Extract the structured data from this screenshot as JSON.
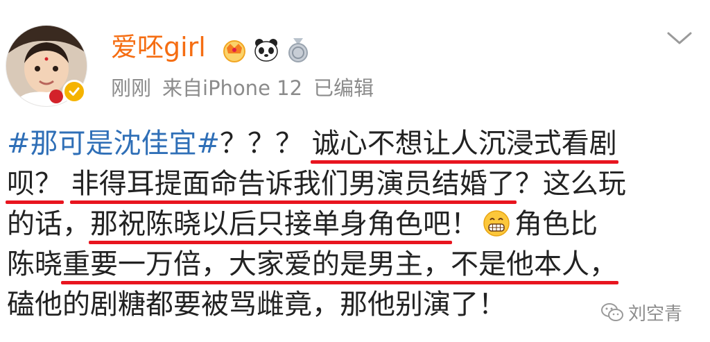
{
  "profile": {
    "username": "爱呸girl",
    "meta_time": "刚刚",
    "meta_source": "来自iPhone 12",
    "meta_edited": "已编辑",
    "badges": [
      "crown-badge-icon",
      "panda-icon",
      "medal-icon"
    ]
  },
  "post": {
    "line1_tag": "#那可是沈佳宜#",
    "line1_a": "？？？ ",
    "line1_b": "诚心不想让人沉浸式看剧",
    "line2_a": "呗？",
    "line2_b": " ",
    "line2_c": "非得耳提面命告诉我们男演员结婚了",
    "line2_d": "？这么玩",
    "line3_a": "的话，",
    "line3_b": "那祝陈晓以后只接单身角色吧",
    "line3_c": "！",
    "line3_d": "角色比",
    "line4_a": "陈晓",
    "line4_b": "重要一万倍，大家爱的是男主，不是他本人，",
    "line5": "磕他的剧糖都要被骂雌竟，那他别演了！"
  },
  "watermark": "刘空青",
  "colors": {
    "username": "#f56d12",
    "hashtag": "#2f6fb7",
    "underline": "#e8151f",
    "meta": "#8b8b8b"
  }
}
